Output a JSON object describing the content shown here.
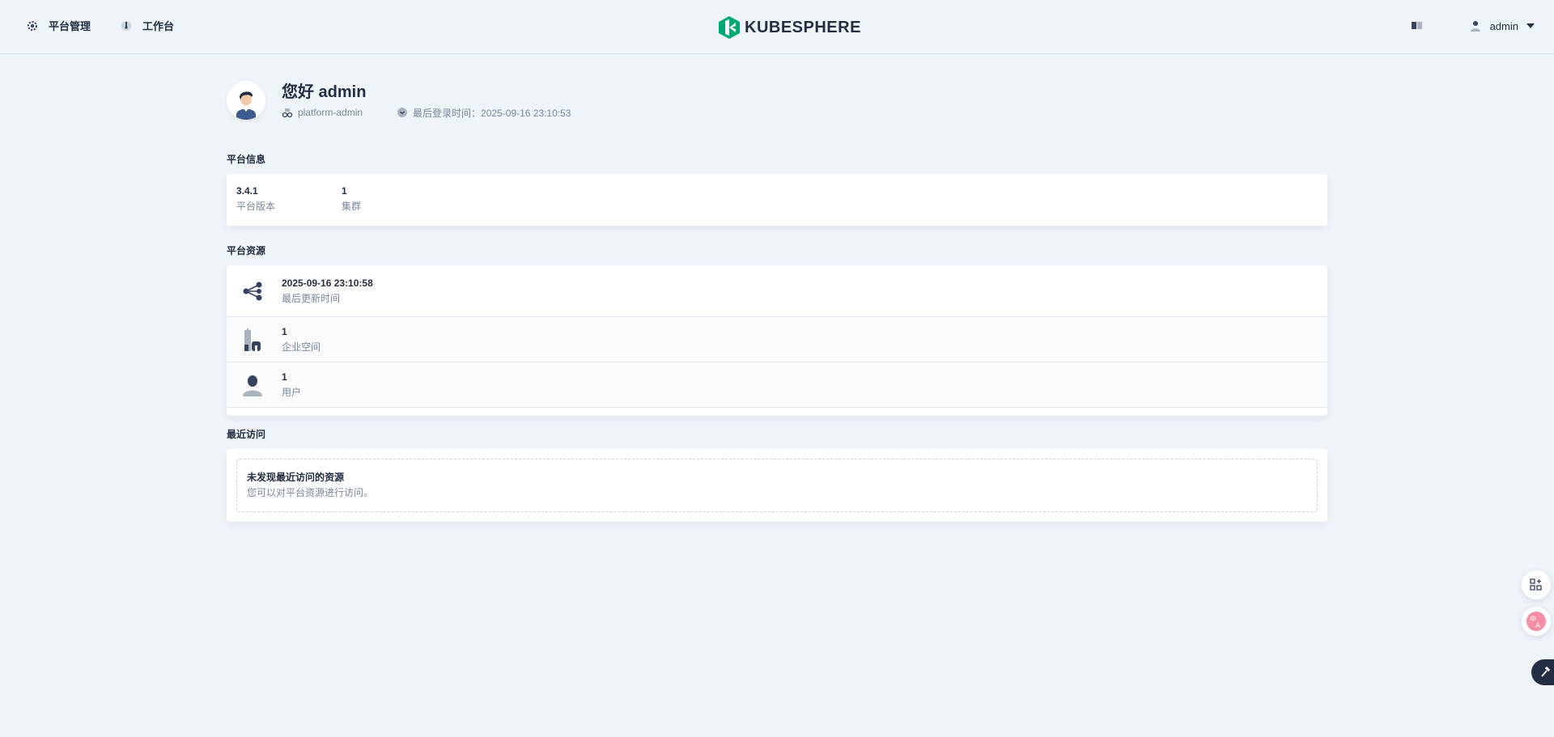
{
  "header": {
    "nav": [
      {
        "label": "平台管理",
        "icon": "gear-icon"
      },
      {
        "label": "工作台",
        "icon": "dashboard-icon"
      }
    ],
    "logo_text": "KUBESPHERE",
    "user": {
      "name": "admin"
    }
  },
  "profile": {
    "greeting": "您好 admin",
    "role": "platform-admin",
    "last_login": "最后登录时间：2025-09-16 23:10:53"
  },
  "platform_info": {
    "title": "平台信息",
    "items": [
      {
        "value": "3.4.1",
        "label": "平台版本"
      },
      {
        "value": "1",
        "label": "集群"
      }
    ]
  },
  "platform_resources": {
    "title": "平台资源",
    "rows": [
      {
        "value": "2025-09-16 23:10:58",
        "label": "最后更新时间",
        "icon": "share-nodes-icon"
      },
      {
        "value": "1",
        "label": "企业空间",
        "icon": "enterprise-icon"
      },
      {
        "value": "1",
        "label": "用户",
        "icon": "user-icon"
      }
    ]
  },
  "recent": {
    "title": "最近访问",
    "empty_title": "未发现最近访问的资源",
    "empty_desc": "您可以对平台资源进行访问。"
  },
  "colors": {
    "accent": "#00a971",
    "text": "#242e42",
    "muted": "#79879c",
    "background": "#eff4f9"
  }
}
